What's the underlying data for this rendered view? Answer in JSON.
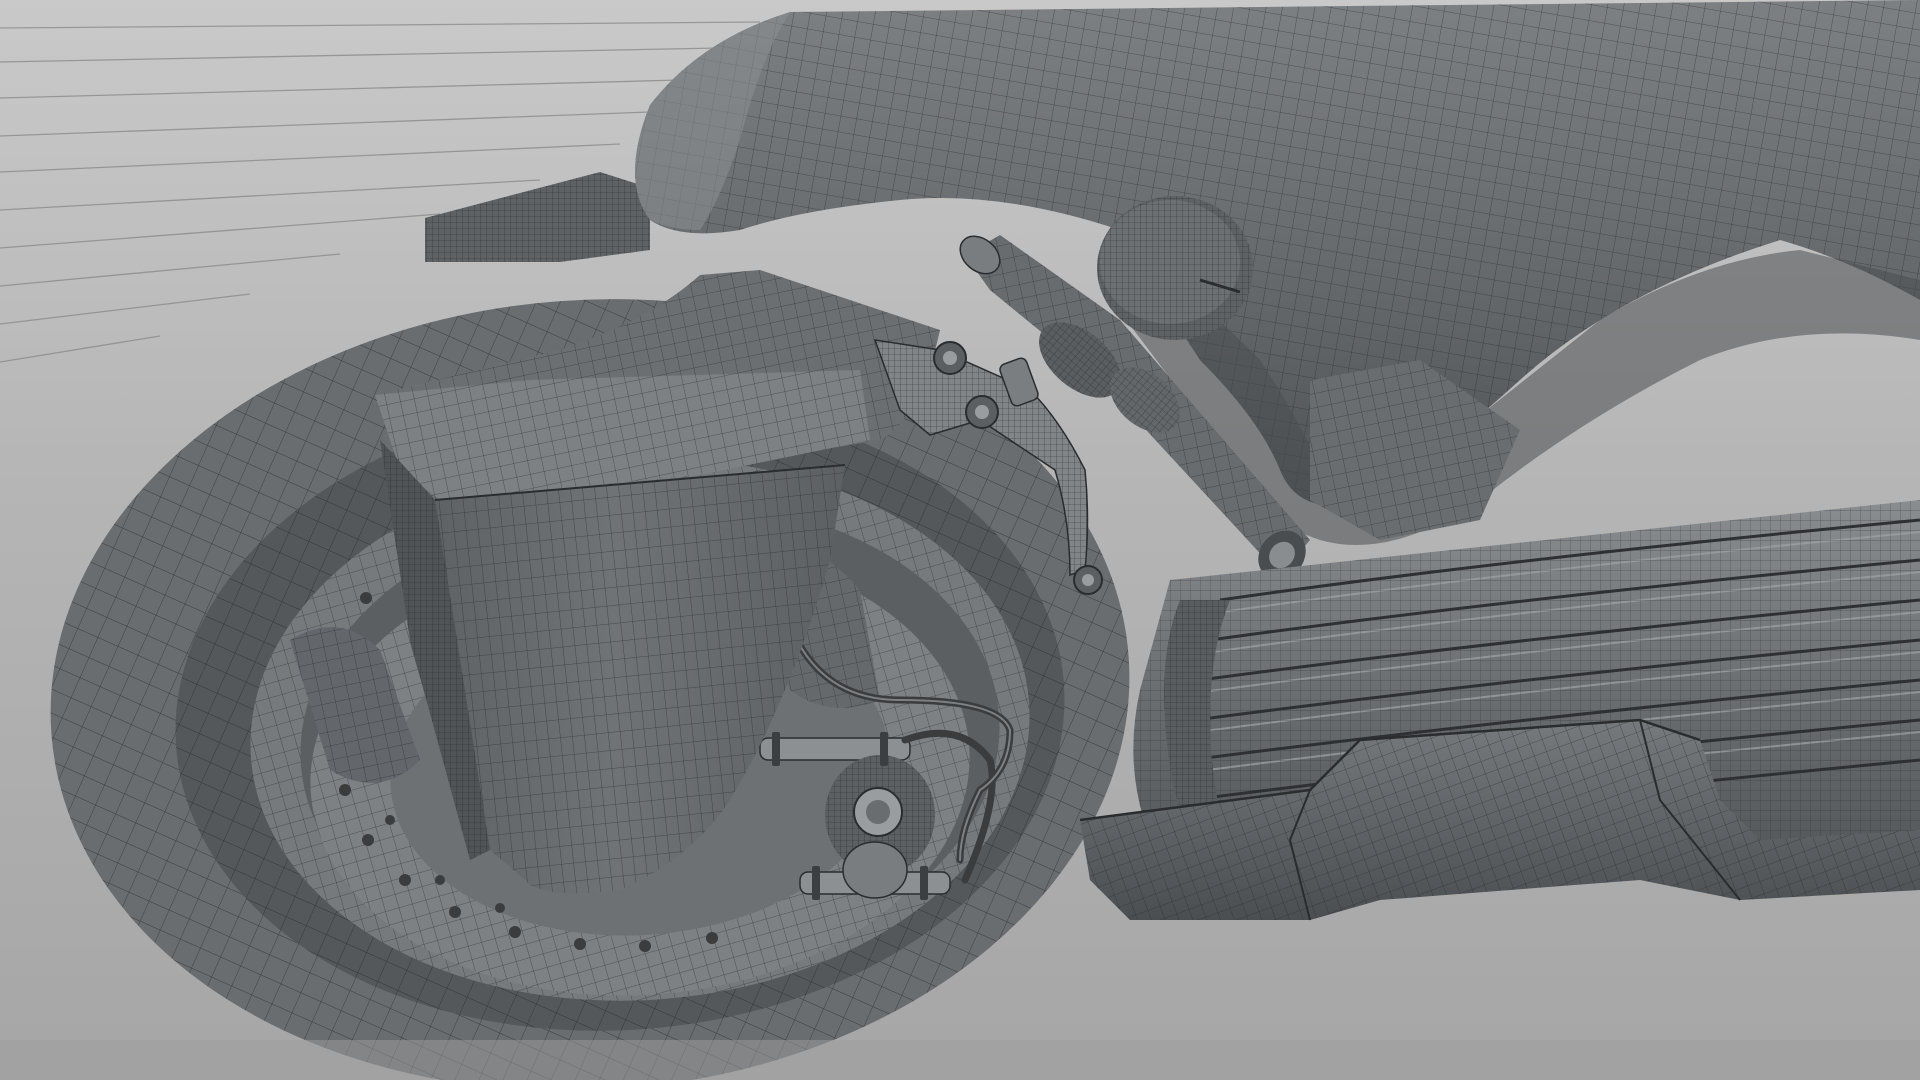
{
  "scene": {
    "subject": "motorcycle-front-wheel-wireframe",
    "colors": {
      "background": "#a9a9a9",
      "background_light": "#c3c3c3",
      "surface_dark": "#5a5d60",
      "surface_mid": "#6e7174",
      "surface_light": "#8c8f92",
      "wire": "#2a2c2e",
      "wire_light": "#3c3f42",
      "highlight": "#a4a7aa"
    },
    "parts": [
      "rear-fender",
      "front-wheel",
      "brake-disc",
      "front-fender",
      "brake-caliper",
      "brake-hose",
      "fuel-tank",
      "handlebar",
      "brake-lever",
      "engine-fins",
      "belly-pan"
    ]
  }
}
